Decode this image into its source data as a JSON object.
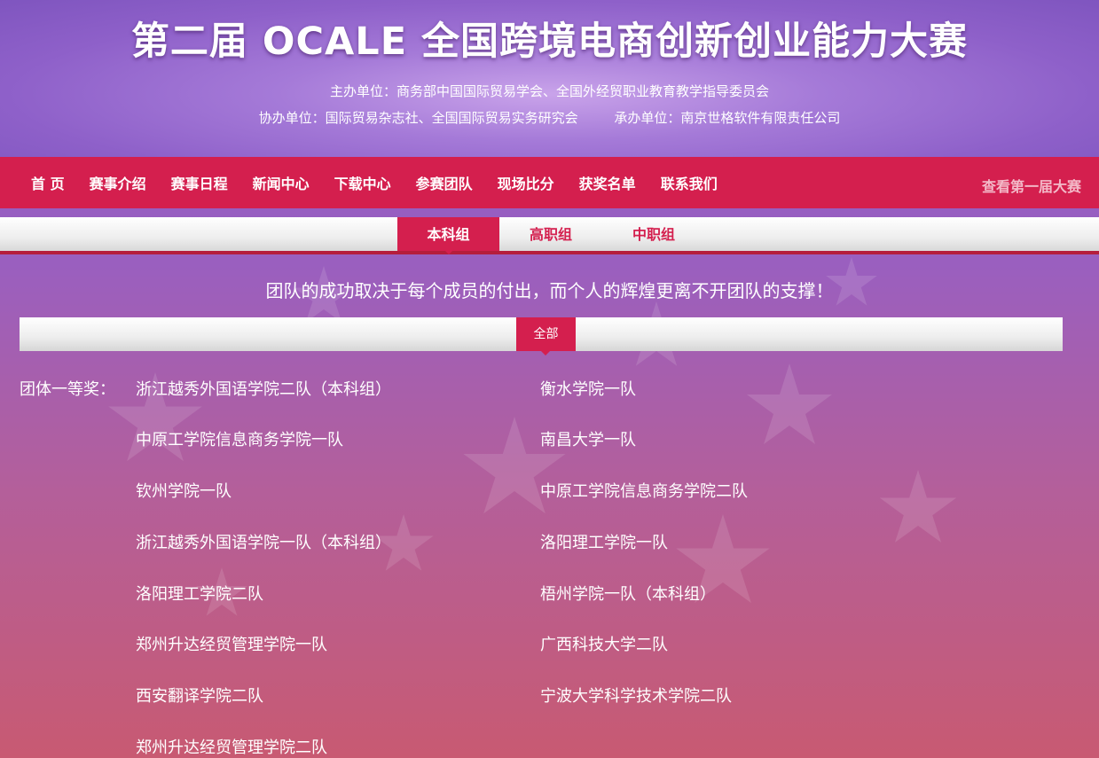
{
  "header": {
    "title": "第二届 OCALE 全国跨境电商创新创业能力大赛",
    "organizer": "主办单位：商务部中国国际贸易学会、全国外经贸职业教育教学指导委员会",
    "co_organizer": "协办单位：国际贸易杂志社、全国国际贸易实务研究会",
    "undertaker": "承办单位：南京世格软件有限责任公司"
  },
  "nav": {
    "items": [
      "首 页",
      "赛事介绍",
      "赛事日程",
      "新闻中心",
      "下载中心",
      "参赛团队",
      "现场比分",
      "获奖名单",
      "联系我们"
    ],
    "right_link": "查看第一届大赛"
  },
  "subtabs": [
    "本科组",
    "高职组",
    "中职组"
  ],
  "motto": "团队的成功取决于每个成员的付出，而个人的辉煌更离不开团队的支撑！",
  "filter": {
    "all_label": "全部"
  },
  "award": {
    "label": "团体一等奖：",
    "left_column": [
      "浙江越秀外国语学院二队（本科组）",
      "中原工学院信息商务学院一队",
      "钦州学院一队",
      "浙江越秀外国语学院一队（本科组）",
      "洛阳理工学院二队",
      "郑州升达经贸管理学院一队",
      "西安翻译学院二队",
      "郑州升达经贸管理学院二队"
    ],
    "right_column": [
      "衡水学院一队",
      "南昌大学一队",
      "中原工学院信息商务学院二队",
      "洛阳理工学院一队",
      "梧州学院一队（本科组）",
      "广西科技大学二队",
      "宁波大学科学技术学院二队"
    ]
  },
  "colors": {
    "accent": "#d41f4e",
    "nav_bg": "#d41f4e",
    "right_link": "#f3b9c8"
  }
}
